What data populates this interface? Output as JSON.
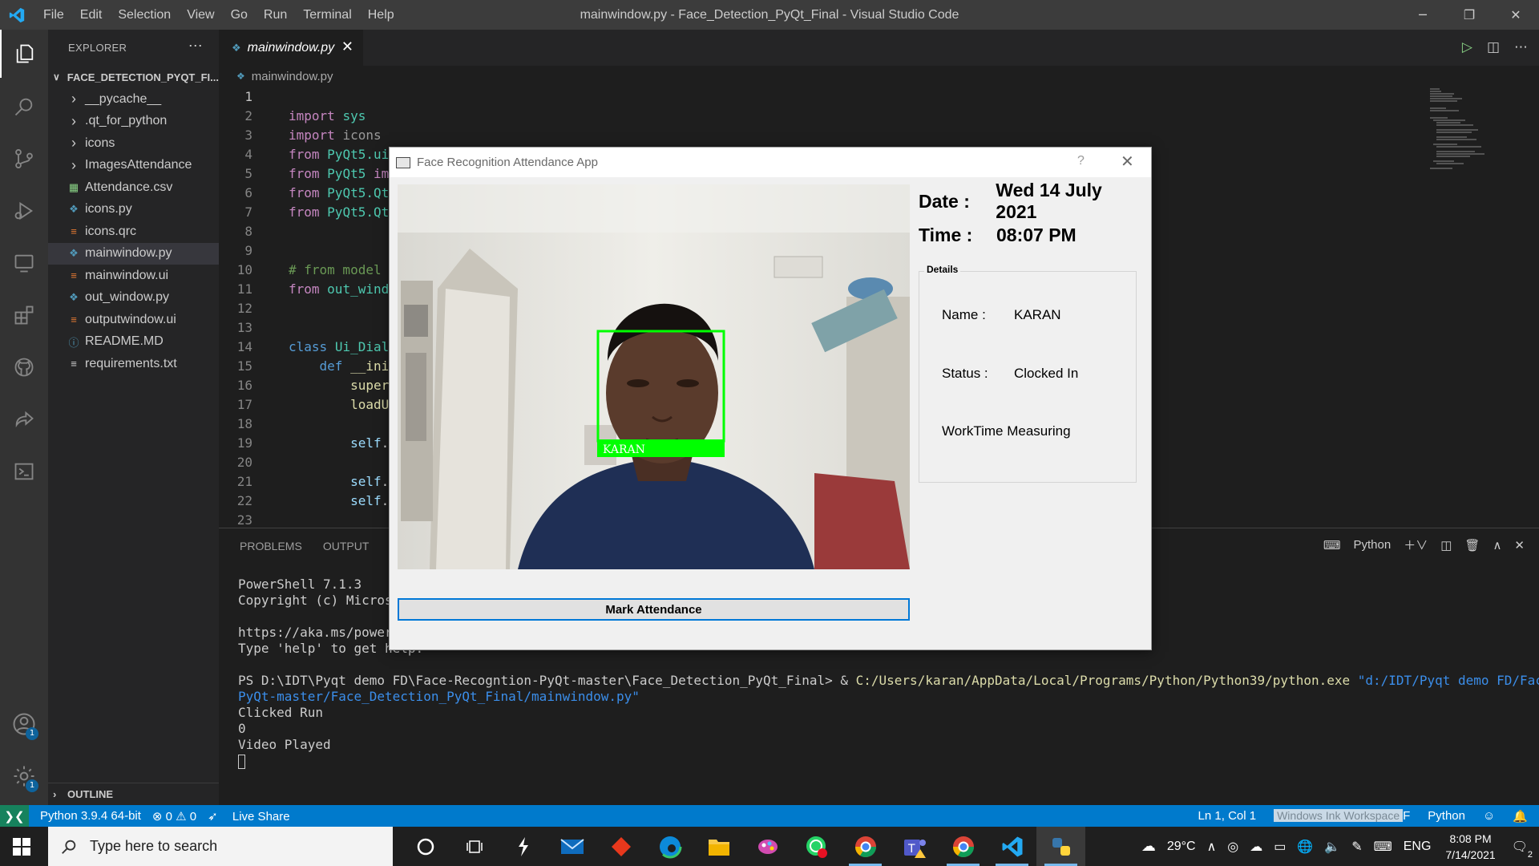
{
  "window": {
    "title": "mainwindow.py - Face_Detection_PyQt_Final - Visual Studio Code",
    "menu": [
      "File",
      "Edit",
      "Selection",
      "View",
      "Go",
      "Run",
      "Terminal",
      "Help"
    ]
  },
  "sidebar": {
    "header": "EXPLORER",
    "folder": "FACE_DETECTION_PYQT_FI...",
    "items": [
      {
        "label": "__pycache__",
        "kind": "folder"
      },
      {
        "label": ".qt_for_python",
        "kind": "folder"
      },
      {
        "label": "icons",
        "kind": "folder"
      },
      {
        "label": "ImagesAttendance",
        "kind": "folder"
      },
      {
        "label": "Attendance.csv",
        "kind": "csv"
      },
      {
        "label": "icons.py",
        "kind": "python"
      },
      {
        "label": "icons.qrc",
        "kind": "xml"
      },
      {
        "label": "mainwindow.py",
        "kind": "python",
        "selected": true
      },
      {
        "label": "mainwindow.ui",
        "kind": "xml"
      },
      {
        "label": "out_window.py",
        "kind": "python"
      },
      {
        "label": "outputwindow.ui",
        "kind": "xml"
      },
      {
        "label": "README.MD",
        "kind": "info"
      },
      {
        "label": "requirements.txt",
        "kind": "text"
      }
    ],
    "outline": "OUTLINE"
  },
  "editor": {
    "tab": "mainwindow.py",
    "breadcrumb": "mainwindow.py",
    "lines": [
      "1",
      "2",
      "3",
      "4",
      "5",
      "6",
      "7",
      "8",
      "9",
      "10",
      "11",
      "12",
      "13",
      "14",
      "15",
      "16",
      "17",
      "18",
      "19",
      "20",
      "21",
      "22",
      "23"
    ]
  },
  "panel": {
    "tabs": [
      "PROBLEMS",
      "OUTPUT",
      "T"
    ],
    "shell": "Python",
    "terminal": {
      "l1": "PowerShell 7.1.3",
      "l2": "Copyright (c) Microso",
      "l3": "https://aka.ms/powers",
      "l4": "Type 'help' to get help.",
      "l5_prompt": "PS D:\\IDT\\Pyqt demo FD\\Face-Recogntion-PyQt-master\\Face_Detection_PyQt_Final> & ",
      "l5_exe": "C:/Users/karan/AppData/Local/Programs/Python/Python39/python.exe",
      "l5_arg": " \"d:/IDT/Pyqt demo FD/Face-Recogntio",
      "l6": "PyQt-master/Face_Detection_PyQt_Final/mainwindow.py\"",
      "l7": "Clicked Run",
      "l8": "0",
      "l9": "Video Played"
    }
  },
  "statusbar": {
    "python": "Python 3.9.4 64-bit",
    "problems": "⊗ 0 ⚠ 0",
    "liveshare": "Live Share",
    "position": "Ln 1, Col 1",
    "ink": "Windows Ink Workspace",
    "ink_tail": "F",
    "lang": "Python"
  },
  "taskbar": {
    "search_placeholder": "Type here to search",
    "temp": "29°C",
    "lang": "ENG",
    "time": "8:08 PM",
    "date": "7/14/2021",
    "notif": "2"
  },
  "dialog": {
    "title": "Face Recognition Attendance App",
    "help": "?",
    "date_label": "Date :",
    "date_value": "Wed 14 July 2021",
    "time_label": "Time :",
    "time_value": "08:07 PM",
    "group_title": "Details",
    "name_label": "Name :",
    "name_value": "KARAN",
    "status_label": "Status :",
    "status_value": "Clocked In",
    "worktime": "WorkTime Measuring",
    "face_label": "KARAN",
    "button": "Mark Attendance"
  },
  "colors": {
    "accent": "#007acc",
    "face_box": "#00ff00"
  }
}
